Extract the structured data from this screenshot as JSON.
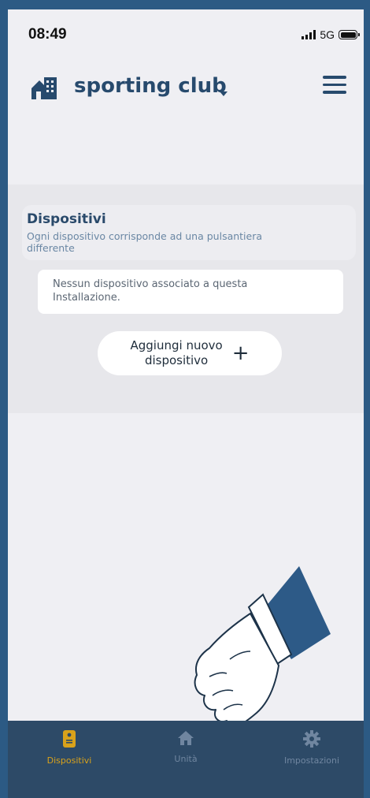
{
  "status_bar": {
    "time": "08:49",
    "network": "5G"
  },
  "header": {
    "title": "sporting club"
  },
  "section": {
    "title": "Dispositivi",
    "subtitle": "Ogni dispositivo corrisponde ad una pulsantiera differente"
  },
  "empty_state": {
    "text": "Nessun dispositivo associato a questa Installazione."
  },
  "add_device": {
    "label_line1": "Aggiungi nuovo",
    "label_line2": "dispositivo",
    "icon": "+"
  },
  "bottom_nav": {
    "items": [
      {
        "label": "Dispositivi",
        "icon": "intercom-icon",
        "active": true
      },
      {
        "label": "Unità",
        "icon": "home-icon",
        "active": false
      },
      {
        "label": "Impostazioni",
        "icon": "gear-icon",
        "active": false
      }
    ]
  },
  "colors": {
    "primary": "#274a6d",
    "background": "#efeff3",
    "nav_background": "#2d4a67",
    "active": "#d9a21b",
    "inactive": "#7086a0"
  }
}
